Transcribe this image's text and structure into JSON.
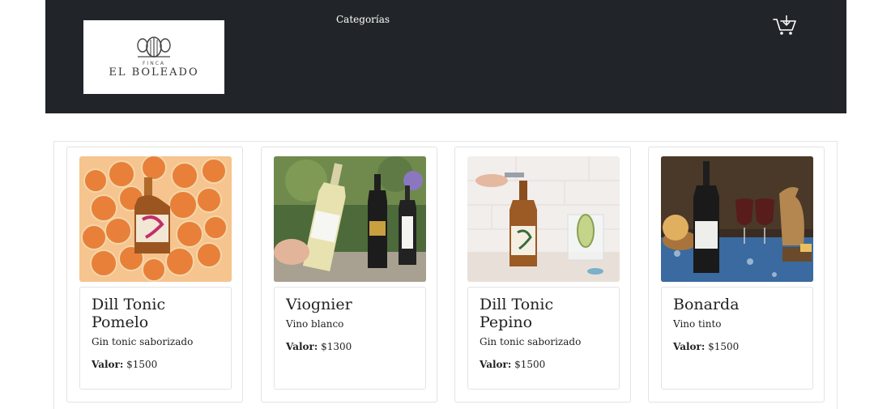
{
  "header": {
    "logo": {
      "small_text": "FINCA",
      "brand": "EL BOLEADO"
    },
    "nav_categorias": "Categorías",
    "cart_icon": "shopping-cart-icon"
  },
  "colors": {
    "header_bg": "#212529",
    "card_border": "#e3e3e3",
    "text": "#222222"
  },
  "products": [
    {
      "name": "Dill Tonic Pomelo",
      "category": "Gin tonic saborizado",
      "price_label": "Valor:",
      "price": "$1500",
      "image": "gin-bottle-grapefruit-slices"
    },
    {
      "name": "Viognier",
      "category": "Vino blanco",
      "price_label": "Valor:",
      "price": "$1300",
      "image": "white-wine-bottles-garden"
    },
    {
      "name": "Dill Tonic Pepino",
      "category": "Gin tonic saborizado",
      "price_label": "Valor:",
      "price": "$1500",
      "image": "gin-bottle-with-cucumber-glass"
    },
    {
      "name": "Bonarda",
      "category": "Vino tinto",
      "price_label": "Valor:",
      "price": "$1500",
      "image": "red-wine-bottle-table"
    }
  ]
}
